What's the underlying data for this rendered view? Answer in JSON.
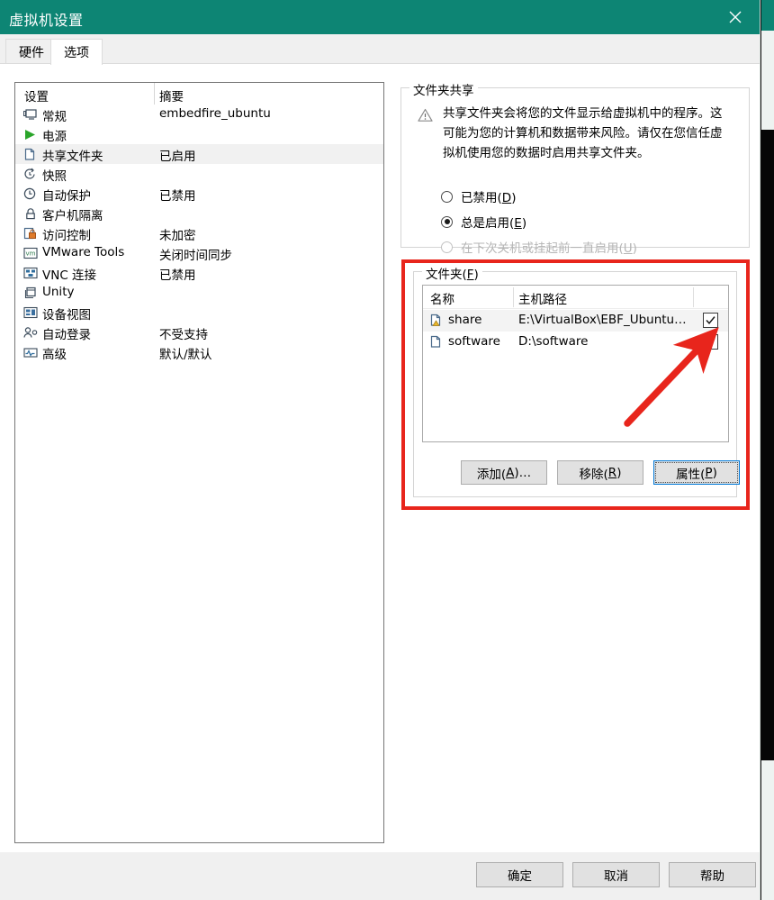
{
  "window": {
    "title": "虚拟机设置",
    "close_icon": "close-icon",
    "accent_color": "#0D8574"
  },
  "tabs": [
    {
      "label": "硬件",
      "active": false
    },
    {
      "label": "选项",
      "active": true
    }
  ],
  "settings_list": {
    "headers": {
      "name": "设置",
      "summary": "摘要"
    },
    "rows": [
      {
        "icon": "monitor-icon",
        "name": "常规",
        "summary": "embedfire_ubuntu",
        "selected": false
      },
      {
        "icon": "play-icon",
        "name": "电源",
        "summary": "",
        "selected": false
      },
      {
        "icon": "folder-icon",
        "name": "共享文件夹",
        "summary": "已启用",
        "selected": true
      },
      {
        "icon": "snapshot-icon",
        "name": "快照",
        "summary": "",
        "selected": false
      },
      {
        "icon": "clock-icon",
        "name": "自动保护",
        "summary": "已禁用",
        "selected": false
      },
      {
        "icon": "lock-icon",
        "name": "客户机隔离",
        "summary": "",
        "selected": false
      },
      {
        "icon": "access-lock-icon",
        "name": "访问控制",
        "summary": "未加密",
        "selected": false
      },
      {
        "icon": "vm-tools-icon",
        "name": "VMware Tools",
        "summary": "关闭时间同步",
        "selected": false
      },
      {
        "icon": "vnc-icon",
        "name": "VNC 连接",
        "summary": "已禁用",
        "selected": false
      },
      {
        "icon": "unity-icon",
        "name": "Unity",
        "summary": "",
        "selected": false
      },
      {
        "icon": "device-view-icon",
        "name": "设备视图",
        "summary": "",
        "selected": false
      },
      {
        "icon": "autologon-icon",
        "name": "自动登录",
        "summary": "不受支持",
        "selected": false
      },
      {
        "icon": "advanced-icon",
        "name": "高级",
        "summary": "默认/默认",
        "selected": false
      }
    ]
  },
  "sharing_group": {
    "title": "文件夹共享",
    "warning_icon": "warning-triangle-icon",
    "warning_text": "共享文件夹会将您的文件显示给虚拟机中的程序。这可能为您的计算机和数据带来风险。请仅在您信任虚拟机使用您的数据时启用共享文件夹。",
    "options": [
      {
        "label_main": "已禁用(",
        "accel": "D",
        "label_tail": ")",
        "selected": false,
        "disabled": false
      },
      {
        "label_main": "总是启用(",
        "accel": "E",
        "label_tail": ")",
        "selected": true,
        "disabled": false
      },
      {
        "label_main": "在下次关机或挂起前一直启用(",
        "accel": "U",
        "label_tail": ")",
        "selected": false,
        "disabled": true
      }
    ]
  },
  "folders_group": {
    "title_main": "文件夹(",
    "title_accel": "F",
    "title_tail": ")",
    "table": {
      "columns": [
        "名称",
        "主机路径",
        ""
      ],
      "rows": [
        {
          "icon": "shared-folder-warning-icon",
          "name": "share",
          "path": "E:\\VirtualBox\\EBF_Ubuntu…",
          "checked": true,
          "selected": true
        },
        {
          "icon": "shared-folder-icon",
          "name": "software",
          "path": "D:\\software",
          "checked": true,
          "selected": false
        }
      ]
    },
    "buttons": [
      {
        "main": "添加(",
        "accel": "A",
        "tail": ")…",
        "focused": false
      },
      {
        "main": "移除(",
        "accel": "R",
        "tail": ")",
        "focused": false
      },
      {
        "main": "属性(",
        "accel": "P",
        "tail": ")",
        "focused": true
      }
    ]
  },
  "dialog_buttons": [
    {
      "label": "确定"
    },
    {
      "label": "取消"
    },
    {
      "label": "帮助"
    }
  ],
  "annotations": {
    "highlight_color": "#E8251C",
    "arrow_color": "#E8251C",
    "arrow_name": "red-arrow-annotation",
    "box_name": "red-highlight-box"
  }
}
